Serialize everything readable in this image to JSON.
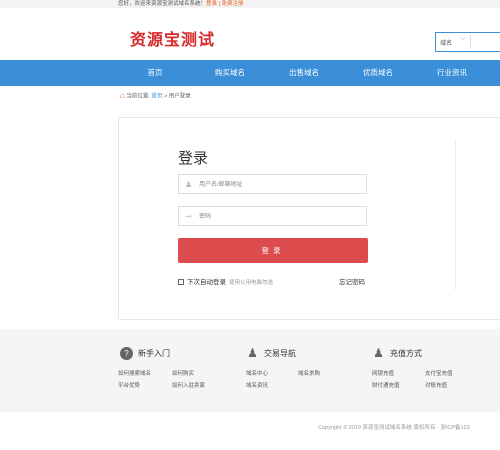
{
  "topbar": {
    "welcome": "您好，欢迎来资源宝测试域名系统！",
    "login": "登录",
    "sep": " | ",
    "register": "免费注册"
  },
  "logo": "资源宝测试",
  "search": {
    "select": "域名",
    "placeholder": ""
  },
  "nav": [
    "首页",
    "购买域名",
    "出售域名",
    "优质域名",
    "行业资讯"
  ],
  "breadcrumb": {
    "prefix": "当前位置:",
    "home": "首页",
    "sep": " > ",
    "current": "用户登录"
  },
  "login": {
    "title": "登录",
    "username_placeholder": "用户名/邮箱地址",
    "password_placeholder": "密码",
    "button": "登录",
    "remember": "下次自动登录",
    "remember_hint": "使用公用电脑勿选",
    "forgot": "忘记密码"
  },
  "footer": {
    "col1": {
      "title": "新手入门",
      "links": [
        "如何搜索域名",
        "如何购买",
        "平台优势",
        "如何入驻卖家"
      ]
    },
    "col2": {
      "title": "交易导航",
      "links": [
        "域名中心",
        "域名求购",
        "域名资讯"
      ]
    },
    "col3": {
      "title": "充值方式",
      "links": [
        "网银充值",
        "支付宝充值",
        "财付通充值",
        "对账充值"
      ]
    }
  },
  "copyright": "Copyright © 2019 资源宝测试域名系统 版权所有 · 浙ICP备123"
}
